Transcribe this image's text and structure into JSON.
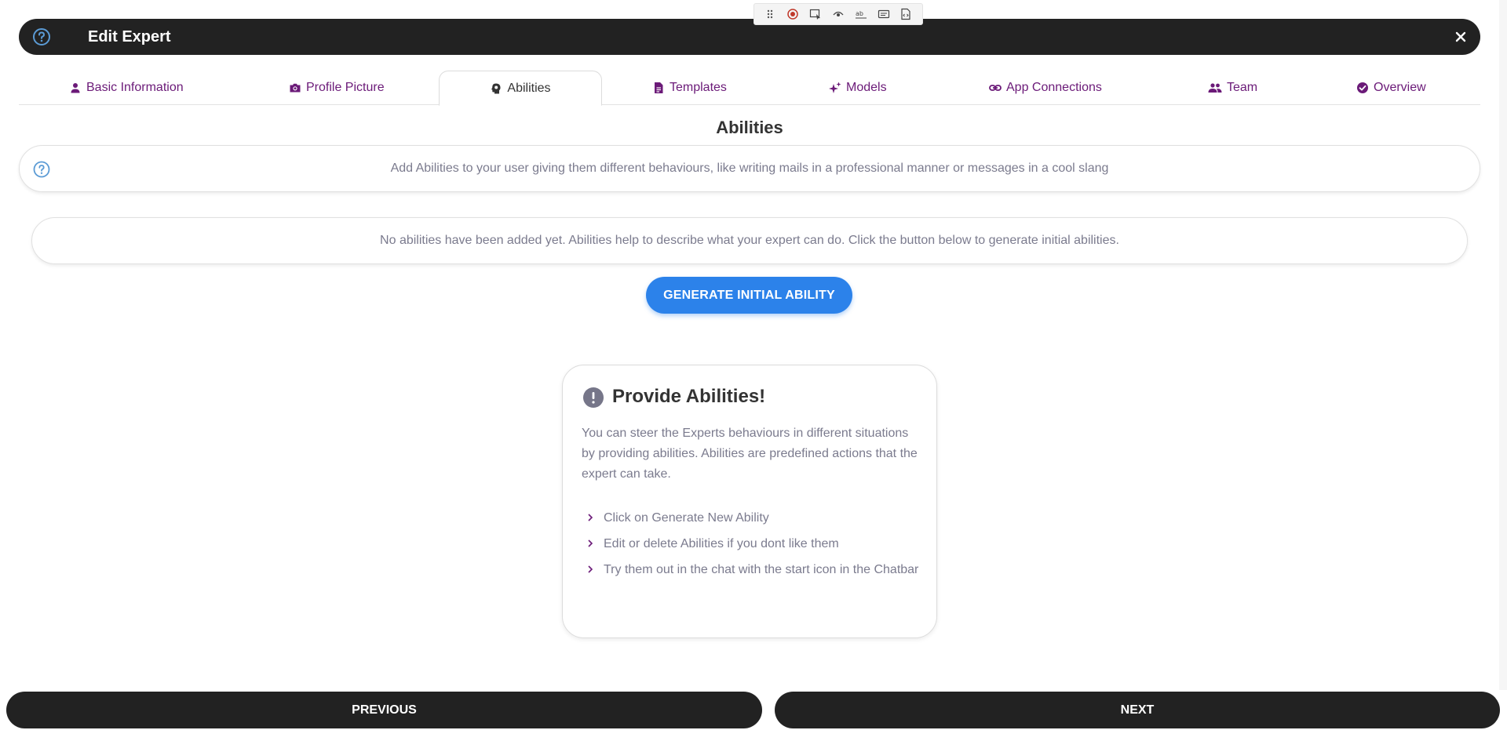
{
  "mini_toolbar": {
    "icons": [
      "drag-handle-icon",
      "record-icon",
      "select-element-icon",
      "preview-icon",
      "spellcheck-icon",
      "caption-icon",
      "code-icon"
    ]
  },
  "header": {
    "title": "Edit Expert",
    "help_icon": "help-circle-icon",
    "close_icon": "close-icon",
    "background": "#222222"
  },
  "tabs": [
    {
      "label": "Basic Information",
      "icon": "person-icon"
    },
    {
      "label": "Profile Picture",
      "icon": "camera-icon"
    },
    {
      "label": "Abilities",
      "icon": "brain-head-icon",
      "active": true
    },
    {
      "label": "Templates",
      "icon": "document-icon"
    },
    {
      "label": "Models",
      "icon": "sparkles-icon"
    },
    {
      "label": "App Connections",
      "icon": "link-icon"
    },
    {
      "label": "Team",
      "icon": "group-icon"
    },
    {
      "label": "Overview",
      "icon": "check-circle-icon"
    }
  ],
  "page": {
    "title": "Abilities",
    "info_text": "Add Abilities to your user giving them different behaviours, like writing mails in a professional manner or messages in a cool slang",
    "empty_text": "No abilities have been added yet. Abilities help to describe what your expert can do. Click the button below to generate initial abilities.",
    "generate_button": "GENERATE INITIAL ABILITY"
  },
  "tip": {
    "title": "Provide Abilities!",
    "description": "You can steer the Experts behaviours in different situations by providing abilities. Abilities are predefined actions that the expert can take.",
    "items": [
      "Click on Generate New Ability",
      "Edit or delete Abilities if you dont like them",
      "Try them out in the chat with the start icon in the Chatbar"
    ]
  },
  "footer": {
    "previous": "PREVIOUS",
    "next": "NEXT"
  },
  "colors": {
    "accent_purple": "#6b1a78",
    "primary_blue": "#2c82ea",
    "help_blue": "#5b9bd5",
    "muted_text": "#7b7b8e",
    "dark": "#222222"
  }
}
